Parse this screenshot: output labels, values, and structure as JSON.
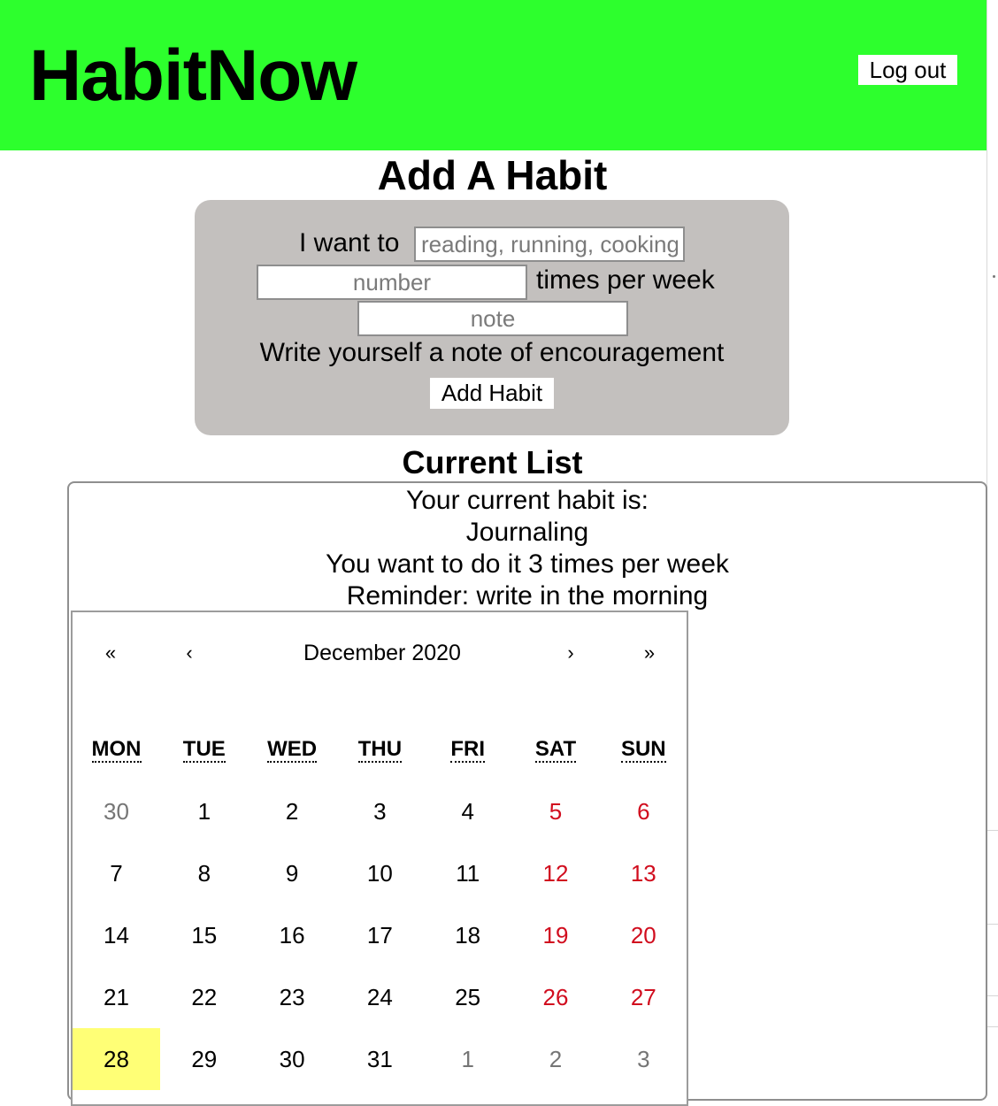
{
  "header": {
    "app_title": "HabitNow",
    "logout_label": "Log out"
  },
  "add_habit": {
    "title": "Add A Habit",
    "i_want_to": "I want to",
    "habit_placeholder": "reading, running, cooking",
    "number_placeholder": "number",
    "times_per_week": "times per week",
    "note_placeholder": "note",
    "note_caption": "Write yourself a note of encouragement",
    "submit_label": "Add Habit"
  },
  "current_list": {
    "title": "Current List",
    "line1": "Your current habit is:",
    "habit_name": "Journaling",
    "frequency_line": "You want to do it 3 times per week",
    "reminder_line": "Reminder: write in the morning"
  },
  "calendar": {
    "prev2": "«",
    "prev": "‹",
    "label": "December 2020",
    "next": "›",
    "next2": "»",
    "weekdays": [
      "MON",
      "TUE",
      "WED",
      "THU",
      "FRI",
      "SAT",
      "SUN"
    ],
    "weeks": [
      [
        "30",
        "1",
        "2",
        "3",
        "4",
        "5",
        "6"
      ],
      [
        "7",
        "8",
        "9",
        "10",
        "11",
        "12",
        "13"
      ],
      [
        "14",
        "15",
        "16",
        "17",
        "18",
        "19",
        "20"
      ],
      [
        "21",
        "22",
        "23",
        "24",
        "25",
        "26",
        "27"
      ],
      [
        "28",
        "29",
        "30",
        "31",
        "1",
        "2",
        "3"
      ]
    ],
    "highlight_color": "#ffff76",
    "weekend_color": "#d10d1e",
    "neighbor_color": "#757575"
  },
  "colors": {
    "header_bg": "#2dff2d",
    "form_bg": "#c3c0be"
  }
}
